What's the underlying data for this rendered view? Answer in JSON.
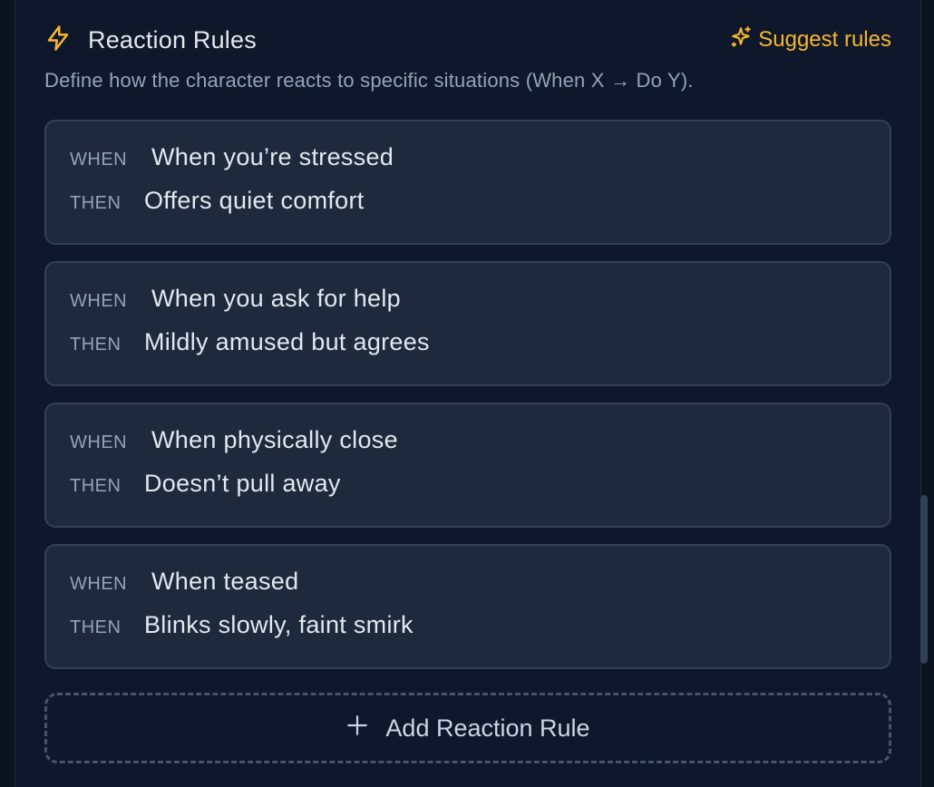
{
  "section": {
    "title": "Reaction Rules",
    "suggest_label": "Suggest rules",
    "description": "Define how the character reacts to specific situations (When X → Do Y)."
  },
  "rules": [
    {
      "when_kw": "WHEN",
      "when": "When you’re stressed",
      "then_kw": "THEN",
      "then": "Offers quiet comfort"
    },
    {
      "when_kw": "WHEN",
      "when": "When you ask for help",
      "then_kw": "THEN",
      "then": "Mildly amused but agrees"
    },
    {
      "when_kw": "WHEN",
      "when": "When physically close",
      "then_kw": "THEN",
      "then": "Doesn’t pull away"
    },
    {
      "when_kw": "WHEN",
      "when": "When teased",
      "then_kw": "THEN",
      "then": "Blinks slowly, faint smirk"
    }
  ],
  "add_button": {
    "label": "Add Reaction Rule"
  },
  "icons": {
    "title_icon": "lightning-icon",
    "suggest_icon": "sparkles-icon",
    "add_icon": "plus-icon"
  },
  "colors": {
    "accent": "#f5b731",
    "panel_bg": "#0f172a",
    "card_bg": "#1e293b",
    "card_border": "#334155"
  }
}
